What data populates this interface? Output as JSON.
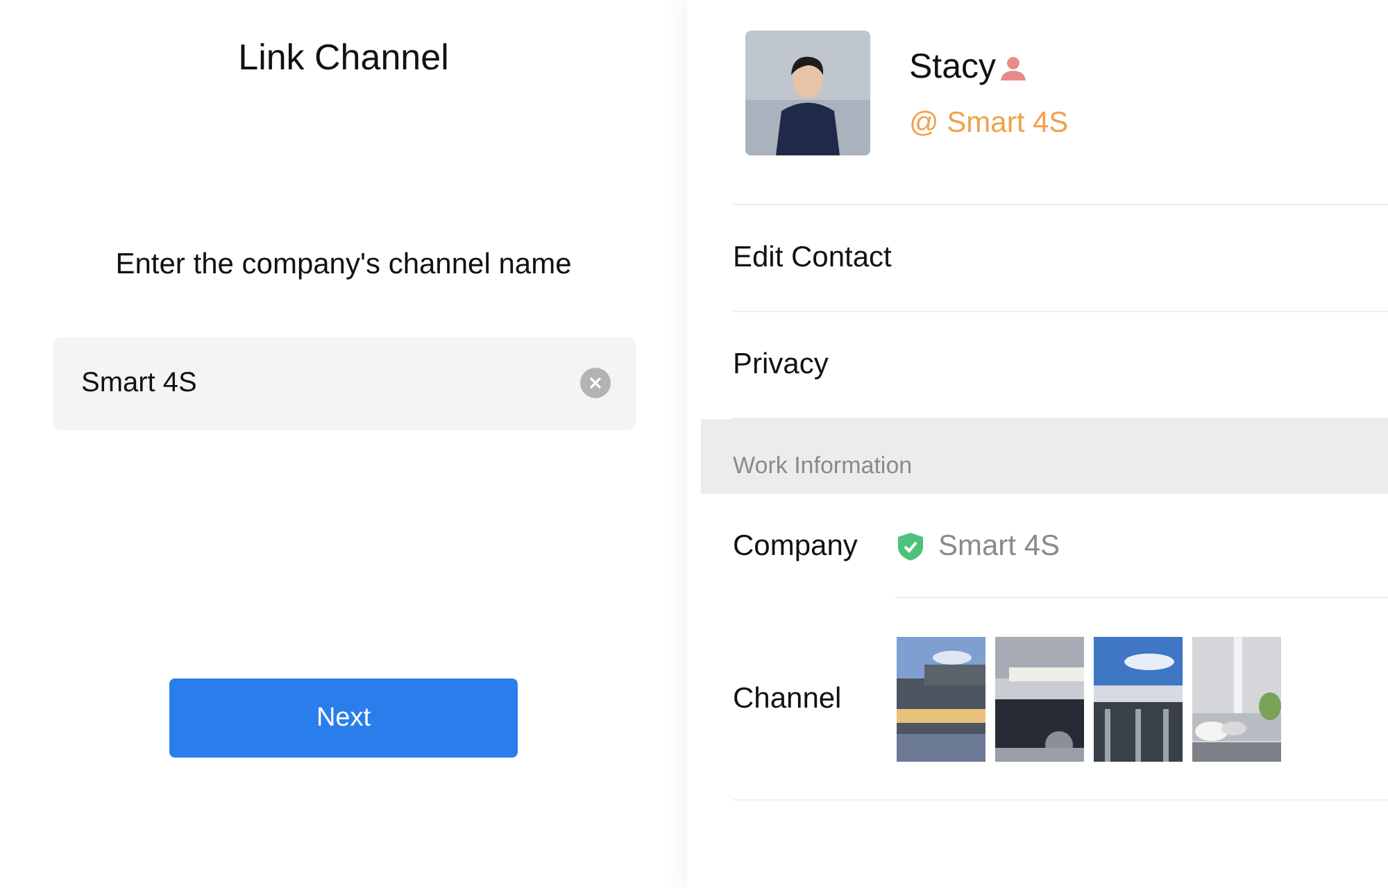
{
  "link_channel": {
    "title": "Link Channel",
    "prompt": "Enter the company's channel name",
    "field": {
      "value": "Smart 4S"
    },
    "next_button": "Next"
  },
  "profile": {
    "name": "Stacy",
    "company_tag": "@ Smart 4S"
  },
  "menu": [
    "Edit Contact",
    "Privacy"
  ],
  "work_information": {
    "heading": "Work Information",
    "company": {
      "label": "Company",
      "value": "Smart 4S",
      "verified": true
    },
    "channel": {
      "label": "Channel"
    }
  }
}
